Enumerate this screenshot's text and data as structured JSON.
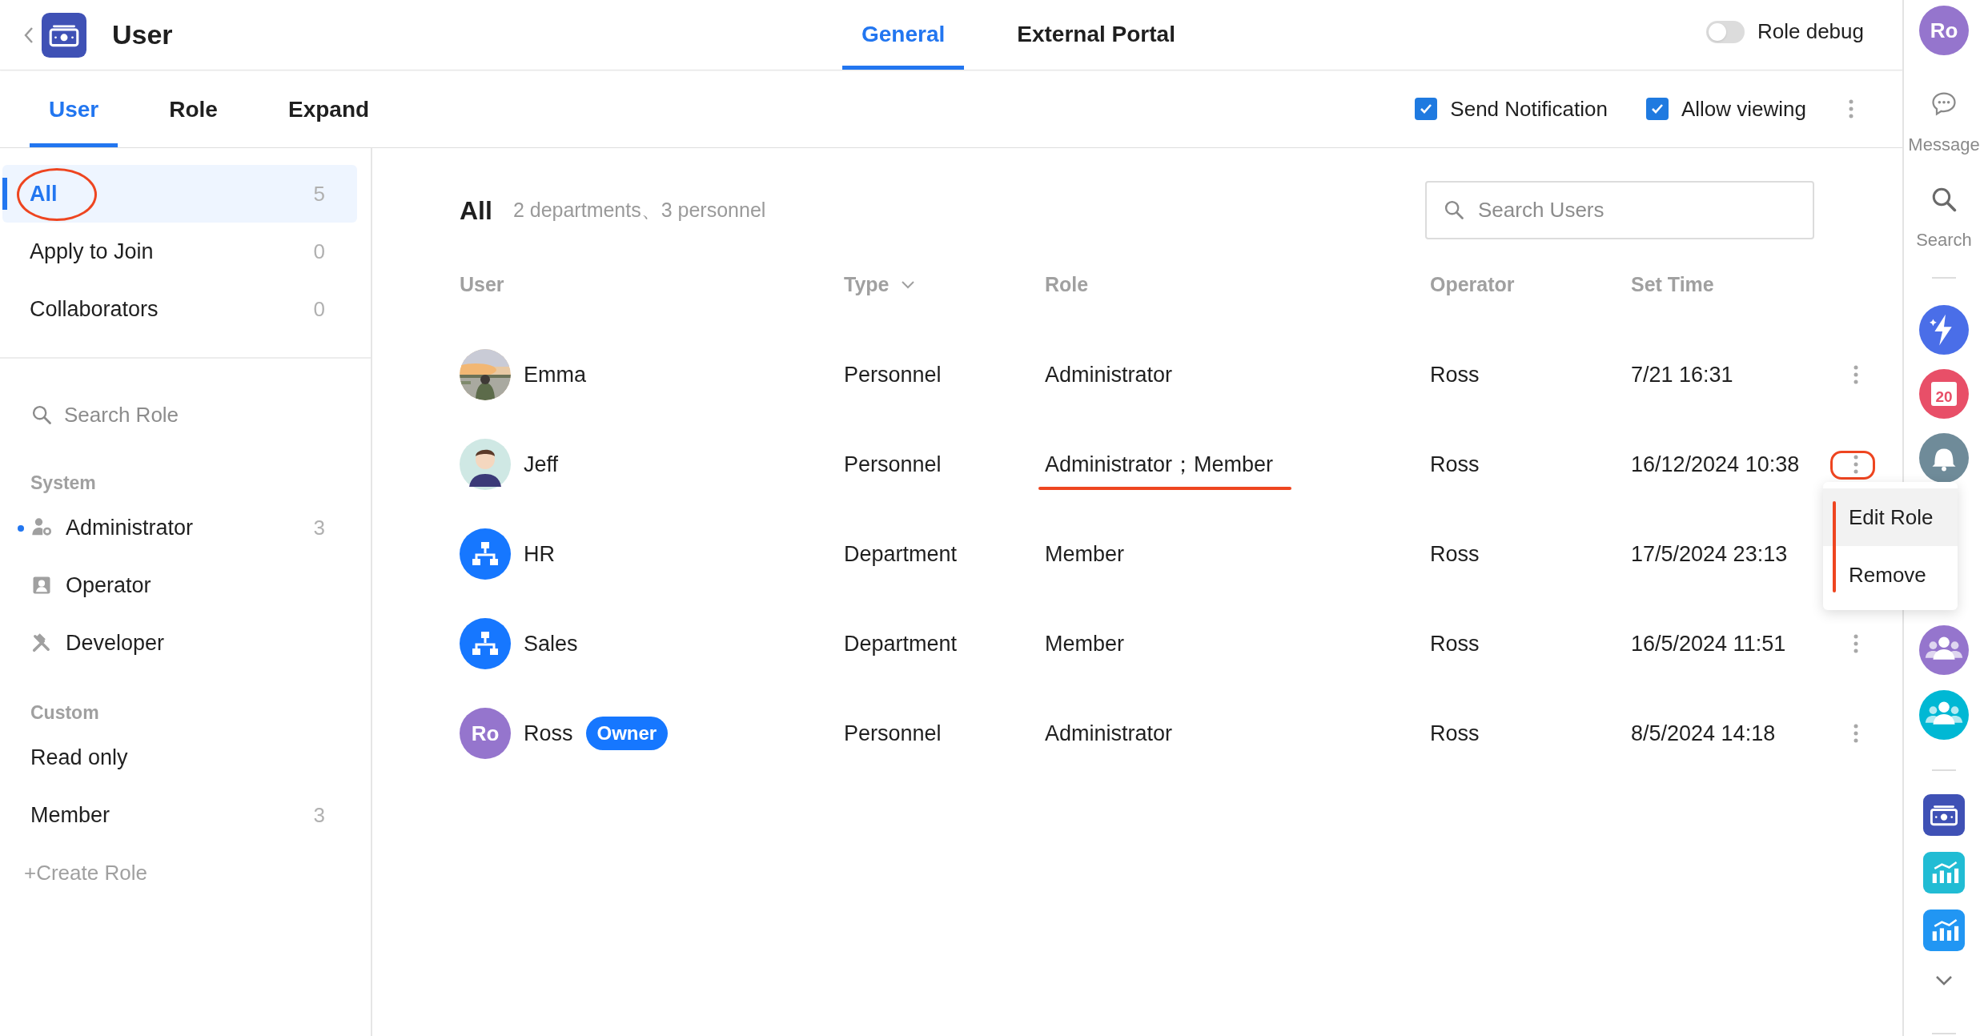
{
  "header": {
    "title": "User",
    "tabs": [
      {
        "label": "General",
        "selected": true
      },
      {
        "label": "External Portal",
        "selected": false
      }
    ],
    "role_debug": {
      "label": "Role debug",
      "on": false
    }
  },
  "subtabs": [
    {
      "label": "User",
      "selected": true
    },
    {
      "label": "Role",
      "selected": false
    },
    {
      "label": "Expand",
      "selected": false
    }
  ],
  "options": [
    {
      "label": "Send Notification",
      "checked": true
    },
    {
      "label": "Allow viewing",
      "checked": true
    }
  ],
  "sidebar": {
    "groups": [
      {
        "label": "All",
        "count": "5",
        "selected": true,
        "marked": true
      },
      {
        "label": "Apply to Join",
        "count": "0",
        "selected": false,
        "marked": false
      },
      {
        "label": "Collaborators",
        "count": "0",
        "selected": false,
        "marked": false
      }
    ],
    "search": {
      "placeholder": "Search Role"
    },
    "sections": [
      {
        "title": "System",
        "items": [
          {
            "kind": "admin",
            "label": "Administrator",
            "count": "3",
            "active": true
          },
          {
            "kind": "operator",
            "label": "Operator",
            "active": false
          },
          {
            "kind": "developer",
            "label": "Developer",
            "active": false
          }
        ]
      },
      {
        "title": "Custom",
        "items": [
          {
            "kind": "plain",
            "label": "Read only",
            "active": false
          },
          {
            "kind": "plain",
            "label": "Member",
            "count": "3",
            "active": false
          }
        ]
      }
    ],
    "create": "+Create Role"
  },
  "main": {
    "title": "All",
    "summary": "2 departments、3 personnel",
    "search": {
      "placeholder": "Search Users"
    },
    "columns": [
      {
        "label": "User",
        "dropdown": false
      },
      {
        "label": "Type",
        "dropdown": true
      },
      {
        "label": "Role",
        "dropdown": false
      },
      {
        "label": "Operator",
        "dropdown": false
      },
      {
        "label": "Set Time",
        "dropdown": false
      }
    ],
    "rows": [
      {
        "name": "Emma",
        "type": "Personnel",
        "role": "Administrator",
        "operator": "Ross",
        "set_time": "7/21 16:31",
        "role_marked": false,
        "menu_marked": false
      },
      {
        "kind": "illustration",
        "name": "Jeff",
        "type": "Personnel",
        "role": "Administrator；Member",
        "operator": "Ross",
        "set_time": "16/12/2024 10:38",
        "role_marked": true,
        "menu_marked": true,
        "menu": {
          "marked": true,
          "items": [
            {
              "label": "Edit Role",
              "selected": true
            },
            {
              "label": "Remove",
              "selected": false
            }
          ]
        }
      },
      {
        "kind": "department",
        "name": "HR",
        "type": "Department",
        "role": "Member",
        "operator": "Ross",
        "set_time": "17/5/2024 23:13",
        "role_marked": false
      },
      {
        "kind": "department",
        "name": "Sales",
        "type": "Department",
        "role": "Member",
        "operator": "Ross",
        "set_time": "16/5/2024 11:51",
        "role_marked": false,
        "menu_marked": false
      },
      {
        "kind": "initials",
        "initials": "Ro",
        "badge": "Owner",
        "name": "Ross",
        "type": "Personnel",
        "role": "Administrator",
        "operator": "Ross",
        "set_time": "8/5/2024 14:18",
        "role_marked": false,
        "menu_marked": false
      }
    ]
  },
  "rail": {
    "avatar": "Ro",
    "items": [
      {
        "kind": "message",
        "label": "Message"
      },
      {
        "kind": "search",
        "label": "Search"
      }
    ],
    "apps": [
      {
        "kind": "lightning",
        "color": "#4a6ee8"
      },
      {
        "kind": "calendar",
        "text": "20",
        "color": "#e84f68"
      },
      {
        "kind": "bell",
        "color": "#6f8b99"
      }
    ],
    "teams": [
      {
        "kind": "group",
        "color": "#9575cd"
      },
      {
        "kind": "group",
        "color": "#00b8d4"
      }
    ],
    "tools": [
      {
        "kind": "money",
        "color": "#3f51b5"
      },
      {
        "kind": "chart",
        "color": "#21bcd4"
      },
      {
        "kind": "chart",
        "color": "#2196f3"
      }
    ]
  }
}
